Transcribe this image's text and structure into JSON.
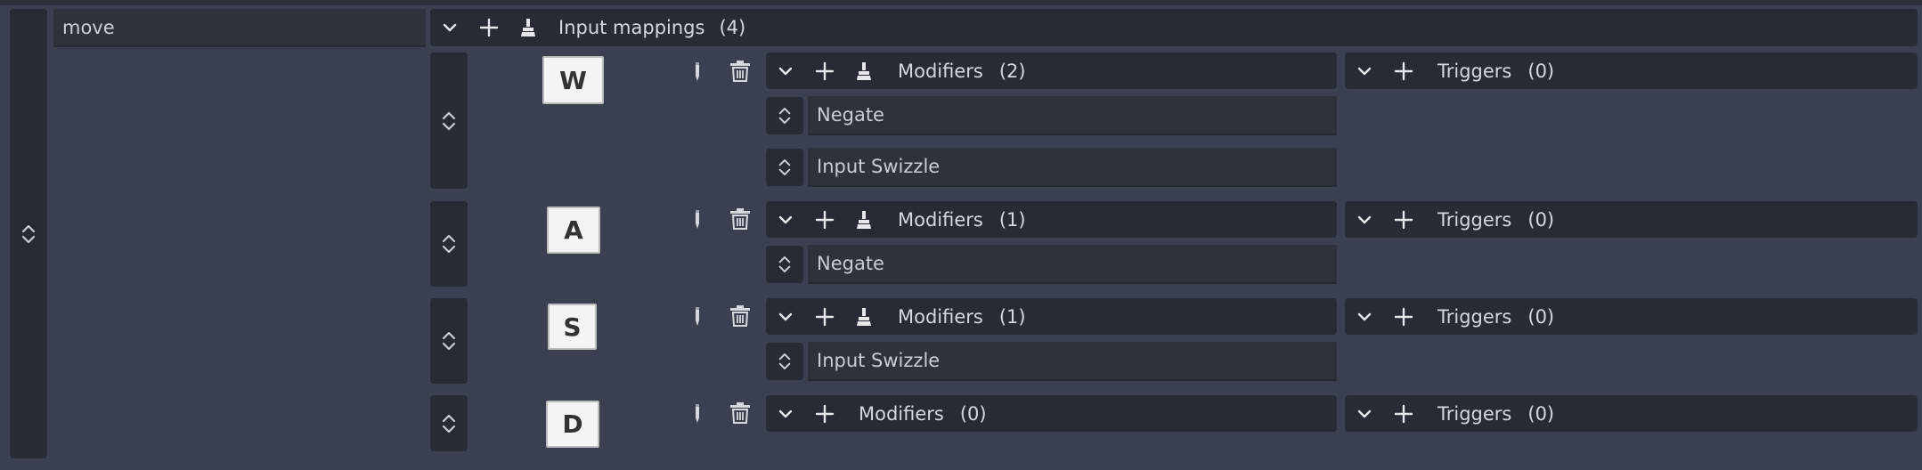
{
  "action": {
    "name": "move"
  },
  "mappings_header": {
    "label": "Input mappings",
    "count": "(4)"
  },
  "mappings": [
    {
      "key": "W",
      "modifiers_label": "Modifiers",
      "modifiers_count": "(2)",
      "triggers_label": "Triggers",
      "triggers_count": "(0)",
      "modifiers": [
        "Negate",
        "Input Swizzle"
      ]
    },
    {
      "key": "A",
      "modifiers_label": "Modifiers",
      "modifiers_count": "(1)",
      "triggers_label": "Triggers",
      "triggers_count": "(0)",
      "modifiers": [
        "Negate"
      ]
    },
    {
      "key": "S",
      "modifiers_label": "Modifiers",
      "modifiers_count": "(1)",
      "triggers_label": "Triggers",
      "triggers_count": "(0)",
      "modifiers": [
        "Input Swizzle"
      ]
    },
    {
      "key": "D",
      "modifiers_label": "Modifiers",
      "modifiers_count": "(0)",
      "triggers_label": "Triggers",
      "triggers_count": "(0)",
      "modifiers": []
    }
  ],
  "colors": {
    "background": "#3a4050",
    "panel": "#262b35",
    "field": "#2d323c",
    "text": "#c9cdd6",
    "key_cap": "#f4f4f4"
  },
  "icons": {
    "collapse": "chevron-down-icon",
    "add": "plus-icon",
    "clear": "broom-icon",
    "edit": "pencil-icon",
    "delete": "trash-icon",
    "drag": "drag-updown-icon"
  }
}
